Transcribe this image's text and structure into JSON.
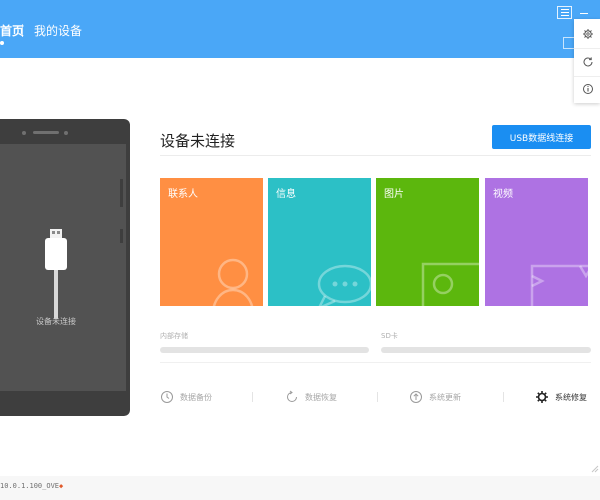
{
  "header": {
    "nav": {
      "home": "首页",
      "my_devices": "我的设备"
    },
    "icons": [
      "menu-icon",
      "minimize-icon"
    ]
  },
  "dropdown": {
    "icons": [
      "settings-icon",
      "refresh-icon",
      "info-icon"
    ]
  },
  "device": {
    "status": "设备未连接",
    "icon": "usb-cable-icon"
  },
  "main": {
    "title": "设备未连接",
    "usb_button": "USB数据线连接",
    "tiles": [
      {
        "label": "联系人",
        "color": "#ff8f43",
        "icon": "contact-icon"
      },
      {
        "label": "信息",
        "color": "#2cc0c6",
        "icon": "message-icon"
      },
      {
        "label": "图片",
        "color": "#5cb70d",
        "icon": "image-icon"
      },
      {
        "label": "视频",
        "color": "#ae72e3",
        "icon": "video-icon"
      }
    ],
    "storage": {
      "internal": "内部存储",
      "sd": "SD卡"
    },
    "tools": [
      {
        "label": "数据备份",
        "icon": "backup-icon"
      },
      {
        "label": "数据恢复",
        "icon": "restore-icon"
      },
      {
        "label": "系统更新",
        "icon": "update-icon"
      },
      {
        "label": "系统修复",
        "icon": "repair-gear-icon"
      }
    ]
  },
  "footer": {
    "version": "10.0.1.100_OVE"
  },
  "colors": {
    "header": "#4aa7f7",
    "accent": "#1a8ef2"
  }
}
